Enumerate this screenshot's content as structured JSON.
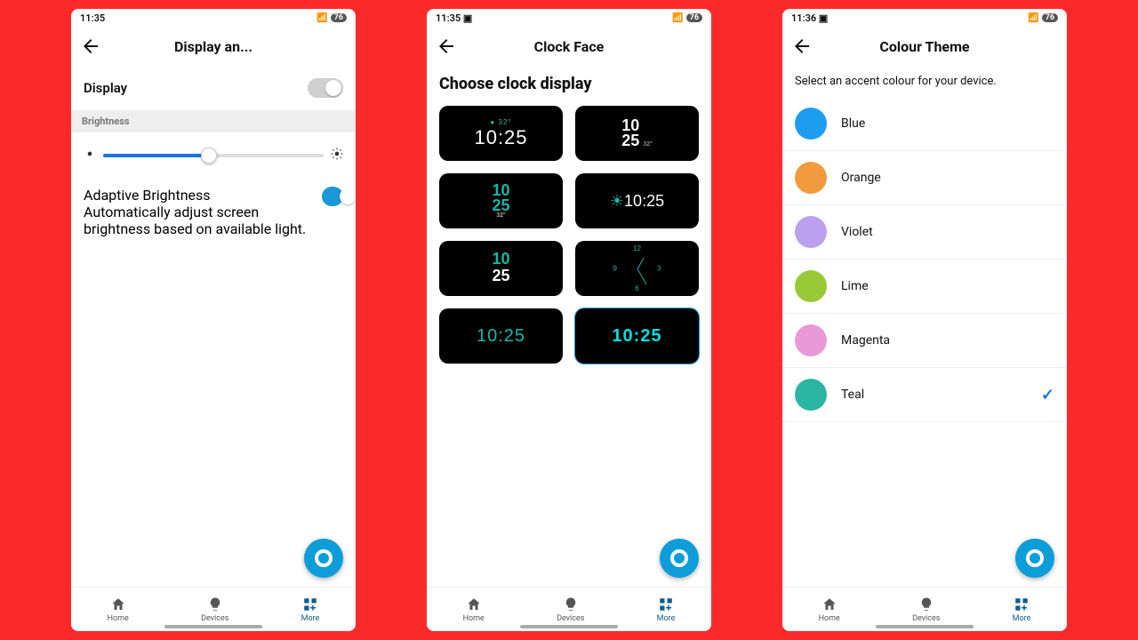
{
  "screens": [
    {
      "status_time": "11:35",
      "status_battery": "76",
      "title": "Display an...",
      "display_label": "Display",
      "display_on": false,
      "brightness_header": "Brightness",
      "brightness_pct": 48,
      "adaptive_title": "Adaptive Brightness",
      "adaptive_desc": "Automatically adjust screen brightness based on available light.",
      "adaptive_on": true
    },
    {
      "status_time": "11:35",
      "status_battery": "76",
      "title": "Clock Face",
      "heading": "Choose clock display",
      "faces": [
        {
          "time": "10:25",
          "temp": "32°",
          "style": "cc1"
        },
        {
          "time_top": "10",
          "time_bot": "25",
          "temp": "32°",
          "style": "cc2"
        },
        {
          "time_top": "10",
          "time_bot": "25",
          "temp": "32°",
          "style": "cc3"
        },
        {
          "time": "10:25",
          "style": "cc4"
        },
        {
          "time_top": "10",
          "time_bot": "25",
          "style": "cc5"
        },
        {
          "style": "analog",
          "h": 10,
          "m": 25
        },
        {
          "time": "10:25",
          "style": "cc7"
        },
        {
          "time": "10:25",
          "style": "cc8",
          "selected": true
        }
      ]
    },
    {
      "status_time": "11:36",
      "status_battery": "76",
      "title": "Colour Theme",
      "desc": "Select an accent colour for your device.",
      "colours": [
        {
          "name": "Blue",
          "hex": "#1e9df0"
        },
        {
          "name": "Orange",
          "hex": "#f19a3e"
        },
        {
          "name": "Violet",
          "hex": "#bba0f0"
        },
        {
          "name": "Lime",
          "hex": "#9ac938"
        },
        {
          "name": "Magenta",
          "hex": "#e99ad6"
        },
        {
          "name": "Teal",
          "hex": "#2bb6a3",
          "selected": true
        }
      ]
    }
  ],
  "nav": {
    "home": "Home",
    "devices": "Devices",
    "more": "More"
  },
  "icons": {
    "screenshot": "▣"
  }
}
